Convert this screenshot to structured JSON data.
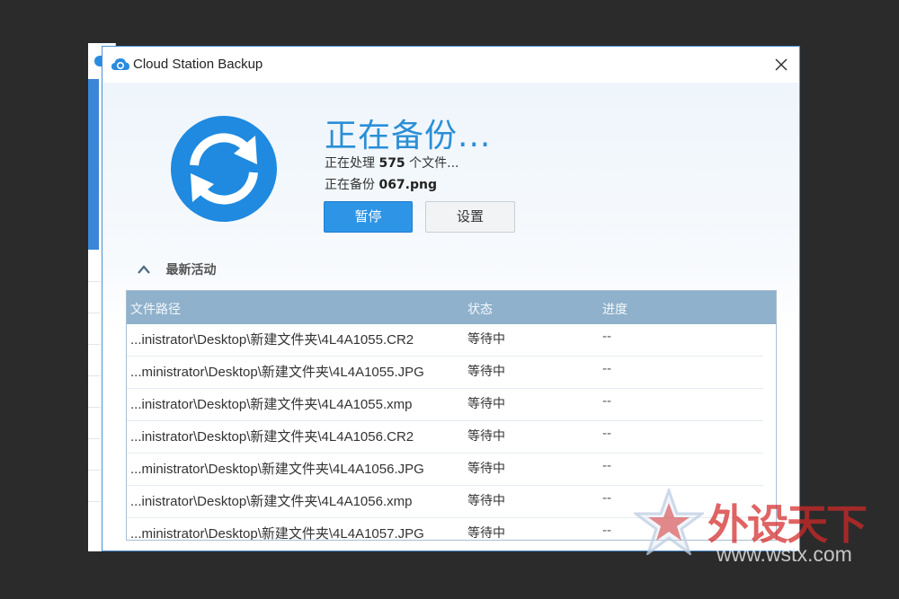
{
  "window": {
    "title": "Cloud Station Backup",
    "app_icon": "cloud-icon",
    "close_icon": "close-icon"
  },
  "status": {
    "heading": "正在备份...",
    "processing_prefix": "正在处理",
    "processing_count": "575",
    "processing_suffix": "个文件...",
    "backing_prefix": "正在备份",
    "backing_file": "067.png",
    "icon": "sync-icon"
  },
  "buttons": {
    "pause": "暂停",
    "settings": "设置"
  },
  "activity": {
    "label": "最新活动",
    "toggle_icon": "chevron-up-icon"
  },
  "table": {
    "headers": {
      "path": "文件路径",
      "status": "状态",
      "progress": "进度"
    },
    "rows": [
      {
        "path": "...inistrator\\Desktop\\新建文件夹\\4L4A1055.CR2",
        "status": "等待中",
        "progress": "--"
      },
      {
        "path": "...ministrator\\Desktop\\新建文件夹\\4L4A1055.JPG",
        "status": "等待中",
        "progress": "--"
      },
      {
        "path": "...inistrator\\Desktop\\新建文件夹\\4L4A1055.xmp",
        "status": "等待中",
        "progress": "--"
      },
      {
        "path": "...inistrator\\Desktop\\新建文件夹\\4L4A1056.CR2",
        "status": "等待中",
        "progress": "--"
      },
      {
        "path": "...ministrator\\Desktop\\新建文件夹\\4L4A1056.JPG",
        "status": "等待中",
        "progress": "--"
      },
      {
        "path": "...inistrator\\Desktop\\新建文件夹\\4L4A1056.xmp",
        "status": "等待中",
        "progress": "--"
      },
      {
        "path": "...ministrator\\Desktop\\新建文件夹\\4L4A1057.JPG",
        "status": "等待中",
        "progress": "--"
      }
    ]
  },
  "watermark": {
    "brand": "外设天下",
    "url": "www.wstx.com"
  },
  "colors": {
    "accent": "#2a8fd6",
    "pause_button": "#2d94e6",
    "table_header": "#8fb1cb",
    "page_background": "#2b2b2b"
  }
}
